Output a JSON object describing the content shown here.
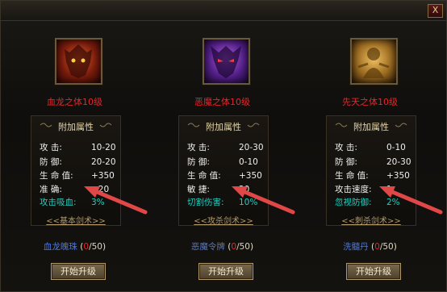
{
  "window": {
    "close_label": "X"
  },
  "columns": [
    {
      "portrait_icon": "red-dragon-demon-icon",
      "title": "血龙之体10级",
      "attr_header": "附加属性",
      "stats": [
        {
          "label": "攻    击:",
          "value": "10-20"
        },
        {
          "label": "防    御:",
          "value": "20-20"
        },
        {
          "label": "生 命 值:",
          "value": "+350"
        },
        {
          "label": "准    确:",
          "value": "+20"
        },
        {
          "label": "攻击吸血:",
          "value": "3%"
        }
      ],
      "sword_link": "<<基本剑术>>",
      "item_name": "血龙魄珠",
      "item_have": "0",
      "item_need": "/50",
      "button": "开始升级"
    },
    {
      "portrait_icon": "purple-demon-icon",
      "title": "恶魔之体10级",
      "attr_header": "附加属性",
      "stats": [
        {
          "label": "攻    击:",
          "value": "20-30"
        },
        {
          "label": "防    御:",
          "value": "0-10"
        },
        {
          "label": "生 命 值:",
          "value": "+350"
        },
        {
          "label": "敏    捷:",
          "value": "20"
        },
        {
          "label": "切割伤害:",
          "value": "10%"
        }
      ],
      "sword_link": "<<攻杀剑术>>",
      "item_name": "恶魔令牌",
      "item_have": "0",
      "item_need": "/50",
      "button": "开始升级"
    },
    {
      "portrait_icon": "golden-sage-icon",
      "title": "先天之体10级",
      "attr_header": "附加属性",
      "stats": [
        {
          "label": "攻    击:",
          "value": "0-10"
        },
        {
          "label": "防    御:",
          "value": "20-30"
        },
        {
          "label": "生 命 值:",
          "value": "+350"
        },
        {
          "label": "攻击速度:",
          "value": "1"
        },
        {
          "label": "忽视防御:",
          "value": "2%"
        }
      ],
      "sword_link": "<<刺杀剑术>>",
      "item_name": "洗髓丹",
      "item_have": "0",
      "item_need": "/50",
      "button": "开始升级"
    }
  ],
  "colors": {
    "title_red": "#e8252a",
    "highlight_cyan": "#1fd0c0",
    "item_blue": "#4f79d8",
    "arrow_red": "#e04848"
  }
}
